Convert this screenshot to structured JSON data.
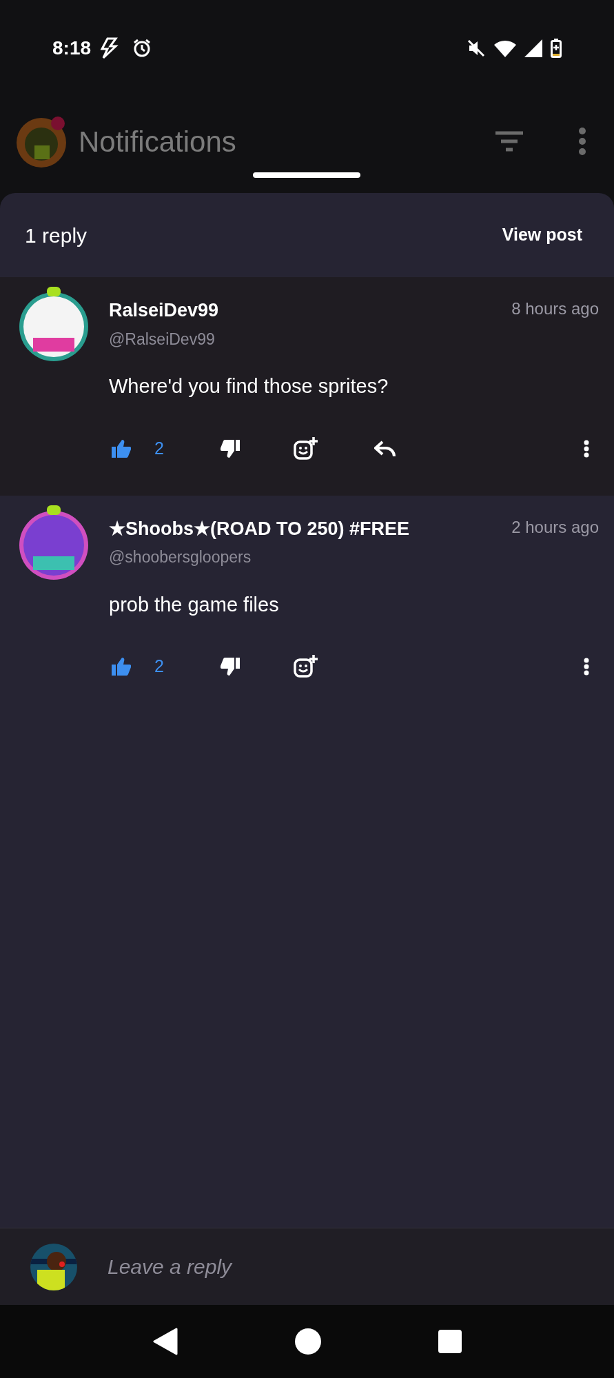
{
  "status_bar": {
    "time": "8:18"
  },
  "app_bar": {
    "title": "Notifications"
  },
  "sheet": {
    "title": "1 reply",
    "view_post": "View post"
  },
  "comments": [
    {
      "name": "RalseiDev99",
      "handle": "@RalseiDev99",
      "time": "8 hours ago",
      "text": "Where'd you find those sprites?",
      "likes": "2",
      "liked": true,
      "can_reply": true,
      "selected": false
    },
    {
      "name": "★Shoobs★(ROAD TO 250) #FREE",
      "handle": "@shoobersgloopers",
      "time": "2 hours ago",
      "text": "prob the game files",
      "likes": "2",
      "liked": true,
      "can_reply": false,
      "selected": true
    }
  ],
  "composer": {
    "placeholder": "Leave a reply"
  }
}
